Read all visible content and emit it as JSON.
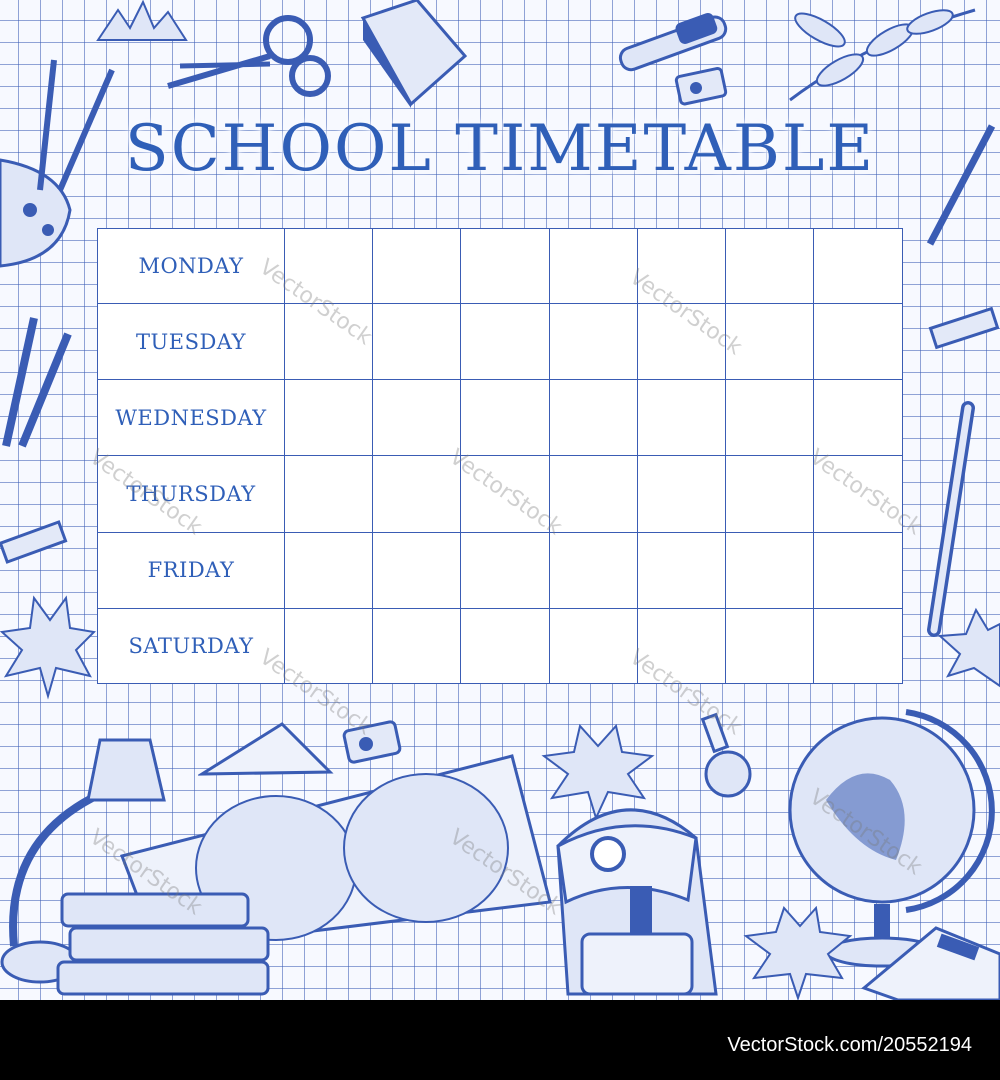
{
  "title": "SCHOOL TIMETABLE",
  "timetable": {
    "days": [
      "MONDAY",
      "TUESDAY",
      "WEDNESDAY",
      "THURSDAY",
      "FRIDAY",
      "SATURDAY"
    ],
    "slot_columns": 7
  },
  "watermark": "VectorStock",
  "footer": {
    "text": "VectorStock.com/20552194"
  },
  "colors": {
    "ink": "#3a5cb4",
    "title": "#2f5fb8",
    "paper": "#f7f9ff"
  },
  "decorations": [
    "maple-leaf-icon",
    "scissors-icon",
    "closed-book-icon",
    "test-tube-icon",
    "sharpener-icon",
    "rowan-branch-icon",
    "paint-palette-icon",
    "paintbrush-icon",
    "pencils-icon",
    "eraser-icon",
    "pen-icon",
    "desk-lamp-icon",
    "ruler-triangle-icon",
    "world-map-icon",
    "book-stack-icon",
    "backpack-icon",
    "flask-icon",
    "globe-icon",
    "calculator-icon"
  ]
}
